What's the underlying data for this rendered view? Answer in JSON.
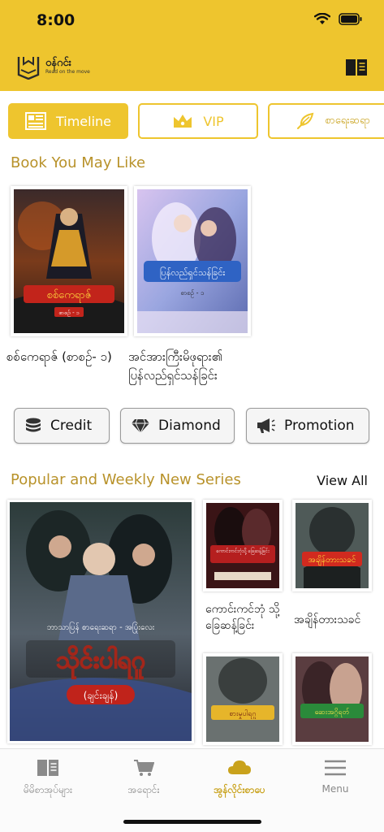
{
  "status_bar": {
    "time": "8:00"
  },
  "app": {
    "logo_name": "ဝန်ဂင်း",
    "logo_tagline": "Read on the move"
  },
  "tabs": [
    {
      "label": "Timeline"
    },
    {
      "label": "VIP"
    },
    {
      "label": "စာရေးဆရာ"
    }
  ],
  "may_like": {
    "title": "Book You May Like",
    "books": [
      {
        "title": "စစ်ကေရာဇ် (စာစဉ်- ၁)",
        "cover_text": "စစ်ကေရာဇ်",
        "cover_sub": "စာစဉ် - ၁"
      },
      {
        "title": "အင်အားကြီးမိဖုရား၏ ပြန်လည်ရှင်သန်ခြင်း",
        "cover_text": "ပြန်လည်ရှင်သန်ခြင်း",
        "cover_sub": "စာစဉ် - ၁"
      }
    ]
  },
  "actions": [
    {
      "label": "Credit"
    },
    {
      "label": "Diamond"
    },
    {
      "label": "Promotion"
    }
  ],
  "series": {
    "title": "Popular and Weekly New Series",
    "view_all": "View All",
    "featured": {
      "cover_text": "သိုင်းပါရဂူ",
      "cover_sub": "(ချင်းချန်)"
    },
    "items": [
      {
        "title": "ကောင်းကင်ဘုံ သို့ခြေဆန့်ခြင်း",
        "cover_text": "ကောင်းကင်ဘုံသို့ ခြေဆန့်ခြင်း"
      },
      {
        "title": "အချိန်တားသခင်",
        "cover_text": "အချိန်တားသခင်"
      },
      {
        "title": "",
        "cover_text": "စားမှုပါရဂူ"
      },
      {
        "title": "",
        "cover_text": "ဆေးအဂ္ဂိရတ်"
      }
    ]
  },
  "bottom_nav": [
    {
      "label": "မိမိစာအုပ်များ",
      "icon": "book-icon"
    },
    {
      "label": "အရောင်း",
      "icon": "cart-icon"
    },
    {
      "label": "အွန်လိုင်းစာပေ",
      "icon": "cloud-icon",
      "active": true
    },
    {
      "label": "Menu",
      "icon": "menu-icon"
    }
  ],
  "colors": {
    "accent": "#eec52e",
    "title": "#b8922a"
  }
}
